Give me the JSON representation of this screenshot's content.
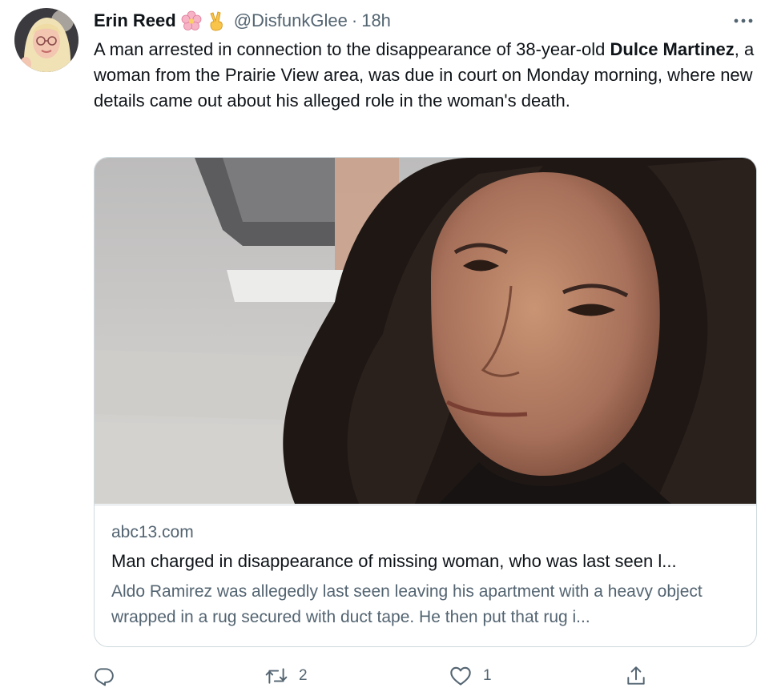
{
  "tweet": {
    "author_name": "Erin Reed",
    "emoji_1": "cherry-blossom",
    "emoji_2": "victory-hand",
    "handle": "@DisfunkGlee",
    "separator": "·",
    "time": "18h",
    "text": {
      "part1": "A man arrested in connection to the disappearance of 38-year-old ",
      "bold": "Dulce Martinez",
      "part2": ", a woman from the Prairie View area, was due in court on Monday morning, where new details came out about his alleged role in the woman's death."
    },
    "card": {
      "domain": "abc13.com",
      "title": "Man charged in disappearance of missing woman, who was last seen l...",
      "description": "Aldo Ramirez was allegedly last seen leaving his apartment with a heavy object wrapped in a rug secured with duct tape. He then put that rug i..."
    },
    "actions": {
      "reply_count": "",
      "retweet_count": "2",
      "like_count": "1"
    }
  },
  "icons": {
    "more": "more-icon",
    "reply": "reply-icon",
    "retweet": "retweet-icon",
    "like": "heart-icon",
    "share": "share-icon"
  },
  "colors": {
    "text": "#0f1419",
    "secondary": "#536471",
    "border": "#cfd9de"
  }
}
